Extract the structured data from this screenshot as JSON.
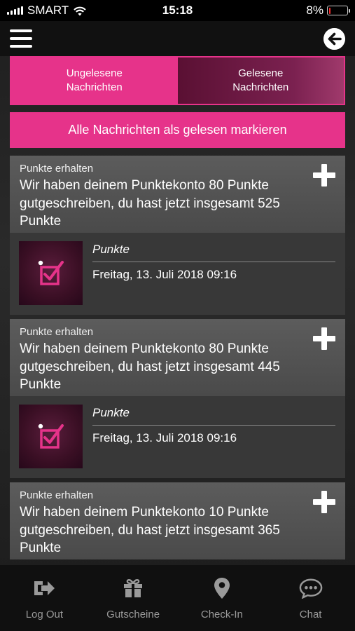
{
  "status_bar": {
    "carrier": "SMART",
    "time": "15:18",
    "battery_percent": "8%",
    "battery_level": 0.08
  },
  "nav": {
    "menu_icon": "hamburger-menu-icon",
    "back_icon": "back-arrow-icon"
  },
  "tabs": {
    "unread_line1": "Ungelesene",
    "unread_line2": "Nachrichten",
    "read_line1": "Gelesene",
    "read_line2": "Nachrichten",
    "selected": "read"
  },
  "mark_all_label": "Alle Nachrichten als gelesen markieren",
  "messages": [
    {
      "category": "Punkte erhalten",
      "text": "Wir haben deinem Punktekonto 80 Punkte gutgeschreiben, du hast jetzt insgesamt 525 Punkte",
      "type": "Punkte",
      "date": "Freitag, 13. Juli 2018 09:16"
    },
    {
      "category": "Punkte erhalten",
      "text": "Wir haben deinem Punktekonto 80 Punkte gutgeschreiben, du hast jetzt insgesamt 445 Punkte",
      "type": "Punkte",
      "date": "Freitag, 13. Juli 2018 09:16"
    },
    {
      "category": "Punkte erhalten",
      "text": "Wir haben deinem Punktekonto 10 Punkte gutgeschreiben, du hast jetzt insgesamt 365 Punkte"
    }
  ],
  "bottom_nav": [
    {
      "label": "Log Out",
      "icon": "logout-icon"
    },
    {
      "label": "Gutscheine",
      "icon": "gift-icon"
    },
    {
      "label": "Check-In",
      "icon": "location-pin-icon"
    },
    {
      "label": "Chat",
      "icon": "chat-bubble-icon"
    }
  ],
  "colors": {
    "accent": "#e6338a",
    "tab_selected": "#7b2150",
    "card_head": "#555555",
    "card_body": "#383838",
    "bottom_bar": "#101010",
    "nav_label": "#9a9a9a"
  }
}
